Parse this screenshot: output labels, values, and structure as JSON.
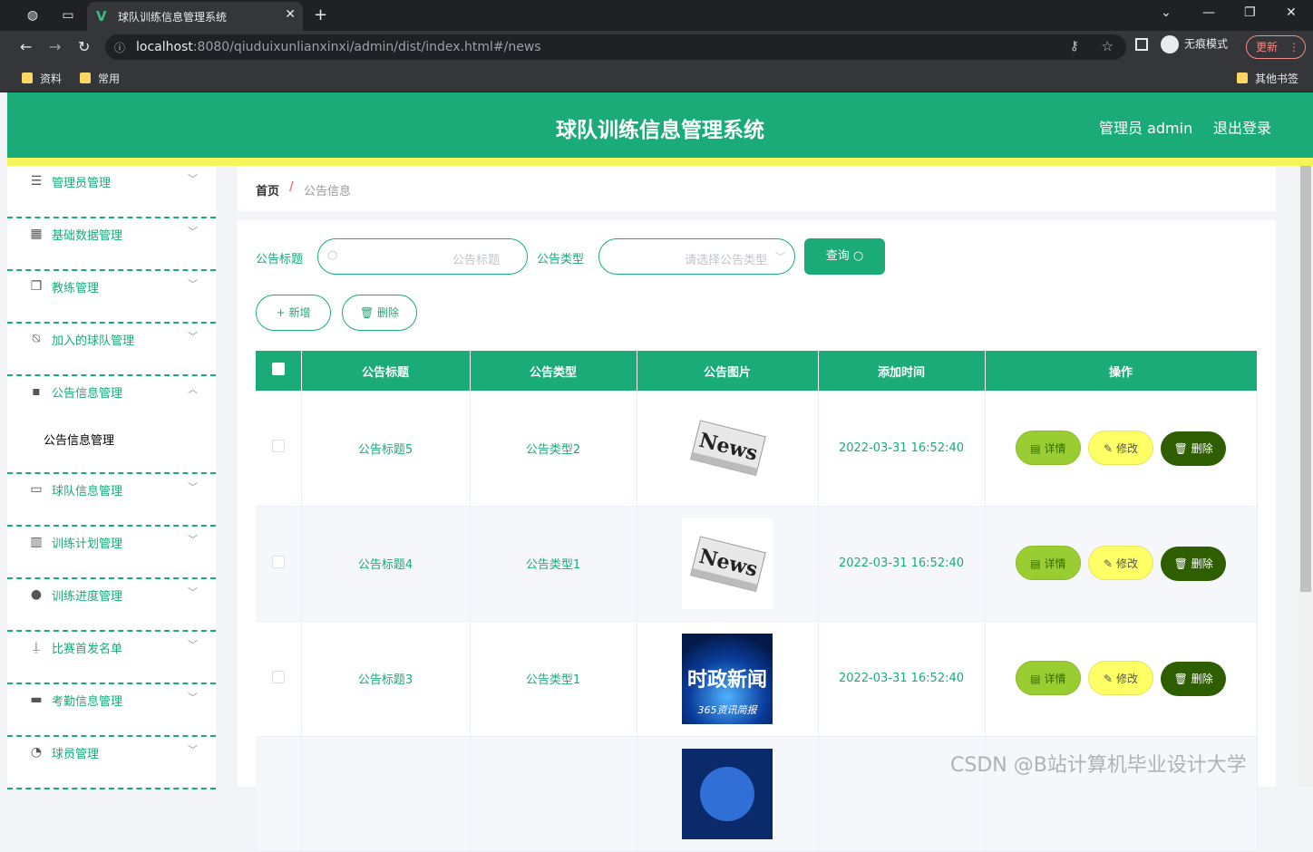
{
  "browser": {
    "tab_title": "球队训练信息管理系统",
    "url_host": "localhost",
    "url_rest": ":8080/qiuduixunlianxinxi/admin/dist/index.html#/news",
    "incognito_label": "无痕模式",
    "update_label": "更新",
    "bookmarks": [
      "资料",
      "常用"
    ],
    "other_bookmarks": "其他书签"
  },
  "header": {
    "title": "球队训练信息管理系统",
    "user_label": "管理员 admin",
    "logout_label": "退出登录"
  },
  "sidebar": {
    "items": [
      {
        "label": "管理员管理",
        "icon": "list-icon"
      },
      {
        "label": "基础数据管理",
        "icon": "grid-icon"
      },
      {
        "label": "教练管理",
        "icon": "copy-icon"
      },
      {
        "label": "加入的球队管理",
        "icon": "bell-off-icon"
      },
      {
        "label": "公告信息管理",
        "icon": "message-icon"
      },
      {
        "label": "球队信息管理",
        "icon": "chat-icon"
      },
      {
        "label": "训练计划管理",
        "icon": "chart-icon"
      },
      {
        "label": "训练进度管理",
        "icon": "user-icon"
      },
      {
        "label": "比赛首发名单",
        "icon": "microphone-icon"
      },
      {
        "label": "考勤信息管理",
        "icon": "monitor-icon"
      },
      {
        "label": "球员管理",
        "icon": "gauge-icon"
      }
    ],
    "submenu_label": "公告信息管理"
  },
  "breadcrumb": {
    "home": "首页",
    "separator": "/",
    "current": "公告信息"
  },
  "search": {
    "title_label": "公告标题",
    "title_placeholder": "公告标题",
    "type_label": "公告类型",
    "type_placeholder": "请选择公告类型",
    "query_label": "查询"
  },
  "actions": {
    "add_label": "新增",
    "delete_label": "删除"
  },
  "table": {
    "headers": [
      "公告标题",
      "公告类型",
      "公告图片",
      "添加时间",
      "操作"
    ],
    "rows": [
      {
        "title": "公告标题5",
        "type": "公告类型2",
        "image": "news",
        "time": "2022-03-31 16:52:40"
      },
      {
        "title": "公告标题4",
        "type": "公告类型1",
        "image": "news",
        "time": "2022-03-31 16:52:40"
      },
      {
        "title": "公告标题3",
        "type": "公告类型1",
        "image": "shizheng",
        "time": "2022-03-31 16:52:40"
      }
    ],
    "row_actions": {
      "detail": "详情",
      "edit": "修改",
      "delete": "删除"
    },
    "image_text": {
      "news": "News",
      "shizheng": "时政新闻",
      "shizheng_sub": "365资讯简报"
    }
  },
  "watermark": "CSDN @B站计算机毕业设计大学",
  "colors": {
    "primary": "#1aab78",
    "strip": "#f5f55a"
  }
}
